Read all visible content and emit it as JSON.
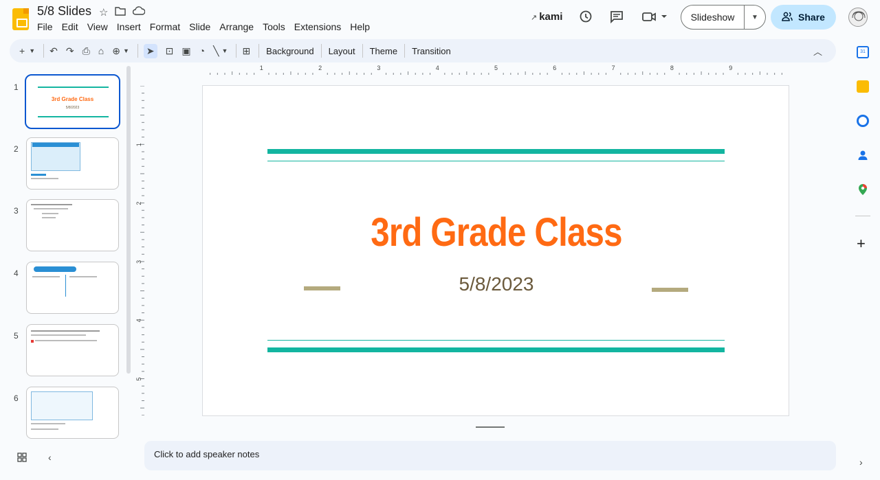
{
  "app": {
    "doc_title": "5/8 Slides",
    "menu": [
      "File",
      "Edit",
      "View",
      "Insert",
      "Format",
      "Slide",
      "Arrange",
      "Tools",
      "Extensions",
      "Help"
    ]
  },
  "header": {
    "kami_label": "kami",
    "slideshow_label": "Slideshow",
    "share_label": "Share"
  },
  "toolbar": {
    "background_label": "Background",
    "layout_label": "Layout",
    "theme_label": "Theme",
    "transition_label": "Transition"
  },
  "rulers": {
    "horizontal": [
      "1",
      "2",
      "3",
      "4",
      "5",
      "6",
      "7",
      "8",
      "9"
    ],
    "vertical": [
      "1",
      "2",
      "3",
      "4",
      "5"
    ]
  },
  "filmstrip": {
    "slides": [
      {
        "number": "1",
        "title": "3rd Grade Class",
        "subtitle": "5/8/2023"
      },
      {
        "number": "2"
      },
      {
        "number": "3"
      },
      {
        "number": "4"
      },
      {
        "number": "5"
      },
      {
        "number": "6"
      }
    ]
  },
  "slide": {
    "title": "3rd Grade Class",
    "subtitle": "5/8/2023",
    "colors": {
      "accent_bar": "#13b5a0",
      "title": "#ff6a13",
      "subtitle": "#6b5a3c",
      "dash": "#b4aa7e"
    }
  },
  "notes": {
    "placeholder": "Click to add speaker notes"
  },
  "side_panel": {
    "icons": [
      "calendar-icon",
      "keep-icon",
      "tasks-icon",
      "contacts-icon",
      "maps-icon"
    ]
  }
}
